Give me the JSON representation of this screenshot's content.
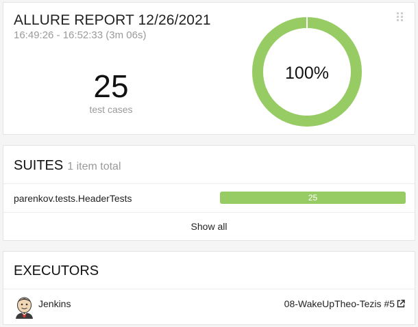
{
  "summary": {
    "title": "ALLURE REPORT 12/26/2021",
    "time_range": "16:49:26 - 16:52:33 (3m 06s)",
    "test_count": "25",
    "test_count_label": "test cases",
    "pass_rate_label": "100%",
    "pass_rate": 1.0,
    "drag_icon": "drag-handle-icon",
    "colors": {
      "passed": "#97cc64",
      "muted_text": "#9a9a9a"
    }
  },
  "suites": {
    "title": "SUITES",
    "subtitle": "1 item total",
    "items": [
      {
        "name": "parenkov.tests.HeaderTests",
        "count": "25",
        "passed_fraction": 1.0
      }
    ],
    "show_all_label": "Show all"
  },
  "executors": {
    "title": "EXECUTORS",
    "items": [
      {
        "name": "Jenkins",
        "build": "08-WakeUpTheo-Tezis #5",
        "icon": "jenkins-avatar-icon",
        "link_icon": "external-link-icon"
      }
    ]
  }
}
